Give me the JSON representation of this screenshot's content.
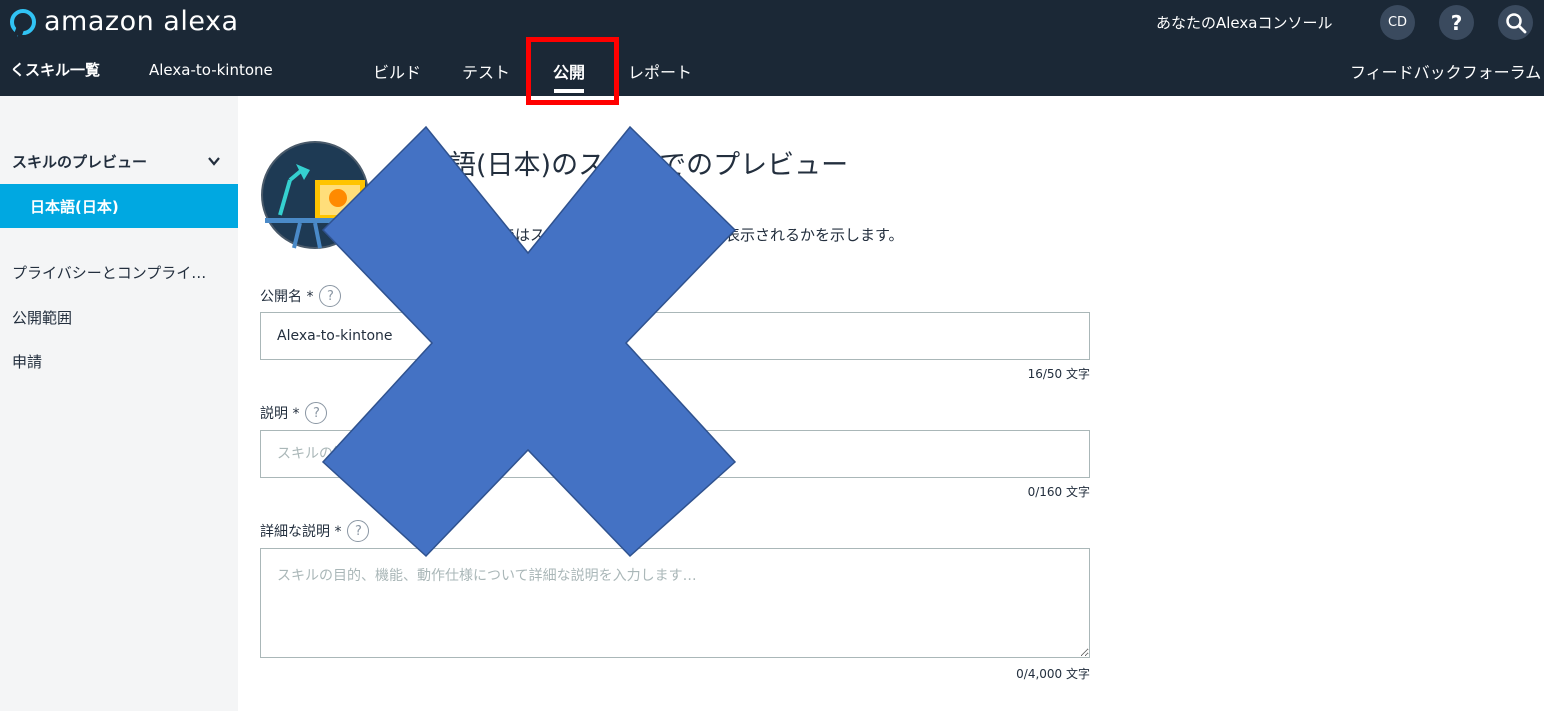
{
  "header": {
    "logo_text": "amazon alexa",
    "console_link": "あなたのAlexaコンソール",
    "avatar_initials": "CD",
    "help_label": "?",
    "back_link": "くスキル一覧",
    "skill_name": "Alexa-to-kintone",
    "tabs": [
      {
        "label": "ビルド",
        "active": false
      },
      {
        "label": "テスト",
        "active": false
      },
      {
        "label": "公開",
        "active": true
      },
      {
        "label": "レポート",
        "active": false
      }
    ],
    "feedback_link": "フィードバックフォーラム"
  },
  "sidebar": {
    "section_title": "スキルのプレビュー",
    "active_item": "日本語(日本)",
    "items": [
      {
        "label": "プライバシーとコンプライ…"
      },
      {
        "label": "公開範囲"
      },
      {
        "label": "申請"
      }
    ]
  },
  "main": {
    "title": "日本語(日本)のストアでのプレビュー",
    "description": "このセクションではスキルがストアでどのように表示されるかを示します。",
    "fields": {
      "public_name": {
        "label": "公開名 *",
        "value": "Alexa-to-kintone",
        "counter": "16/50 文字"
      },
      "summary": {
        "label": "説明 *",
        "placeholder": "スキルの簡単な説明を入力します",
        "counter": "0/160 文字"
      },
      "detailed": {
        "label": "詳細な説明 *",
        "placeholder": "スキルの目的、機能、動作仕様について詳細な説明を入力します…",
        "counter": "0/4,000 文字"
      }
    }
  },
  "colors": {
    "header_bg": "#1b2836",
    "sidebar_active": "#00a8e1",
    "highlight_box": "#ff0000",
    "overlay_x": "#4472c4"
  }
}
